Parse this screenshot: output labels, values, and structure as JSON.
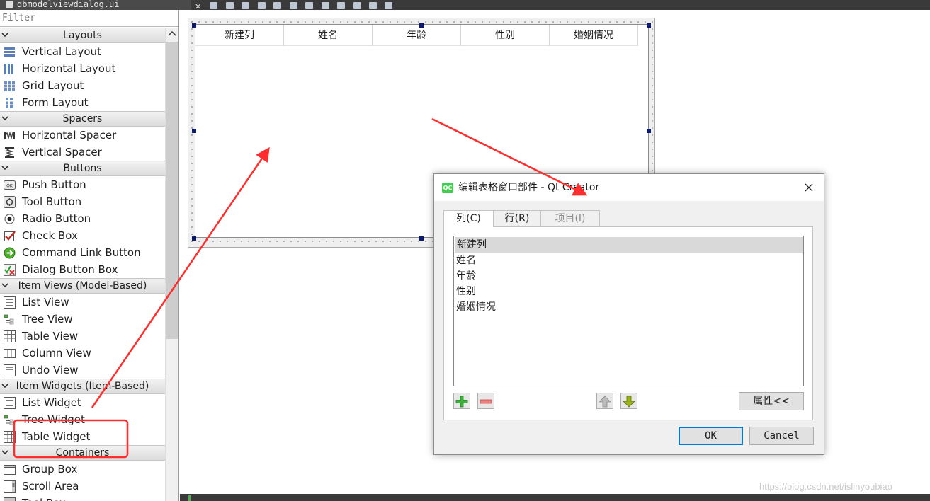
{
  "file_tab": {
    "name": "dbmodelviewdialog.ui"
  },
  "widget_box": {
    "filter_placeholder": "Filter",
    "categories": [
      {
        "label": "Layouts",
        "items": [
          {
            "label": "Vertical Layout",
            "icon": "vertical-layout-icon"
          },
          {
            "label": "Horizontal Layout",
            "icon": "horizontal-layout-icon"
          },
          {
            "label": "Grid Layout",
            "icon": "grid-layout-icon"
          },
          {
            "label": "Form Layout",
            "icon": "form-layout-icon"
          }
        ]
      },
      {
        "label": "Spacers",
        "items": [
          {
            "label": "Horizontal Spacer",
            "icon": "horizontal-spacer-icon"
          },
          {
            "label": "Vertical Spacer",
            "icon": "vertical-spacer-icon"
          }
        ]
      },
      {
        "label": "Buttons",
        "items": [
          {
            "label": "Push Button",
            "icon": "push-button-icon"
          },
          {
            "label": "Tool Button",
            "icon": "tool-button-icon"
          },
          {
            "label": "Radio Button",
            "icon": "radio-button-icon"
          },
          {
            "label": "Check Box",
            "icon": "check-box-icon"
          },
          {
            "label": "Command Link Button",
            "icon": "command-link-icon"
          },
          {
            "label": "Dialog Button Box",
            "icon": "dialog-button-box-icon"
          }
        ]
      },
      {
        "label": "Item Views (Model-Based)",
        "items": [
          {
            "label": "List View",
            "icon": "list-view-icon"
          },
          {
            "label": "Tree View",
            "icon": "tree-view-icon"
          },
          {
            "label": "Table View",
            "icon": "table-view-icon"
          },
          {
            "label": "Column View",
            "icon": "column-view-icon"
          },
          {
            "label": "Undo View",
            "icon": "undo-view-icon"
          }
        ]
      },
      {
        "label": "Item Widgets (Item-Based)",
        "items": [
          {
            "label": "List Widget",
            "icon": "list-widget-icon"
          },
          {
            "label": "Tree Widget",
            "icon": "tree-widget-icon"
          },
          {
            "label": "Table Widget",
            "icon": "table-widget-icon"
          }
        ]
      },
      {
        "label": "Containers",
        "items": [
          {
            "label": "Group Box",
            "icon": "group-box-icon"
          },
          {
            "label": "Scroll Area",
            "icon": "scroll-area-icon"
          },
          {
            "label": "Tool Box",
            "icon": "tool-box-icon"
          }
        ]
      }
    ]
  },
  "form": {
    "table_headers": [
      "新建列",
      "姓名",
      "年龄",
      "性别",
      "婚姻情况"
    ]
  },
  "dialog": {
    "title": "编辑表格窗口部件 - Qt Creator",
    "app_badge": "QC",
    "tabs": [
      {
        "label": "列(C)",
        "state": "active"
      },
      {
        "label": "行(R)",
        "state": "normal"
      },
      {
        "label": "项目(I)",
        "state": "disabled"
      }
    ],
    "columns": [
      "新建列",
      "姓名",
      "年龄",
      "性别",
      "婚姻情况"
    ],
    "selected_index": 0,
    "properties_button": "属性<<",
    "ok_button": "OK",
    "cancel_button": "Cancel"
  },
  "annotation": {
    "highlight_color": "#ff2d2d"
  },
  "watermark": "https://blog.csdn.net/islinyoubiao"
}
